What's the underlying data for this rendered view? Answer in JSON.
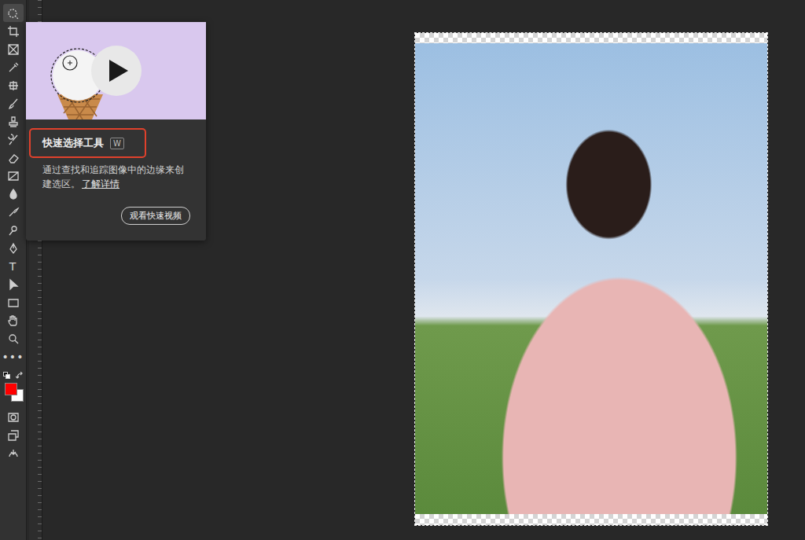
{
  "tooltip": {
    "title": "快速选择工具",
    "shortcut": "W",
    "title_highlighted": true,
    "description": "通过查找和追踪图像中的边缘来创建选区。",
    "link": "了解详情",
    "button": "观看快速视频"
  },
  "tools": [
    {
      "selected": true
    },
    {
      "selected": false
    },
    {
      "selected": false
    },
    {
      "selected": false
    },
    {
      "selected": false
    },
    {
      "selected": false
    },
    {
      "selected": false
    },
    {
      "selected": false
    },
    {
      "selected": false
    },
    {
      "selected": false
    },
    {
      "selected": false
    },
    {
      "selected": false
    },
    {
      "selected": false
    },
    {
      "selected": false
    },
    {
      "selected": false,
      "glyph": "T"
    },
    {
      "selected": false
    },
    {
      "selected": false
    },
    {
      "selected": false
    },
    {
      "selected": false
    },
    {
      "selected": false,
      "glyph": "•••"
    }
  ],
  "swatches": [
    {
      "name": "foreground",
      "color": "#ff0000"
    },
    {
      "name": "background",
      "color": "#ffffff"
    }
  ],
  "bottom_tools": [
    {
      "selected": false
    },
    {
      "selected": false
    },
    {
      "selected": false
    }
  ]
}
